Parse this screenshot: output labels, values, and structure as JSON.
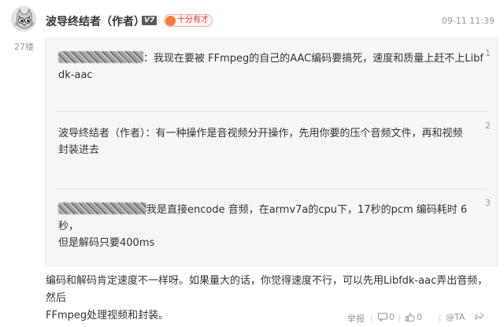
{
  "floor_label": "27楼",
  "author": {
    "name": "波导终结者（作者）",
    "level": "V7",
    "badge": "十分有才"
  },
  "timestamp": "09-11 11:39",
  "quotes": [
    {
      "number": "1",
      "speaker_hidden": true,
      "line1": "：我现在要被 FFmpeg的自己的AAC编码要搞死，速度和质量上赶不上Libf",
      "line2": "dk-aac"
    },
    {
      "number": "2",
      "speaker": "波导终结者（作者）",
      "line1": "：有一种操作是音视频分开操作，先用你要的压个音频文件，再和视频",
      "line2": "封装进去"
    },
    {
      "number": "3",
      "speaker_hidden": true,
      "line1": "我是直接encode 音频，在armv7a的cpu下，17秒的pcm 编码耗时 6秒，",
      "line2": "但是解码只要400ms"
    }
  ],
  "reply": {
    "line1": "编码和解码肯定速度不一样呀。如果量大的话，你觉得速度不行，可以先用Libfdk-aac弄出音频，然后",
    "line2": "FFmpeg处理视频和封装。"
  },
  "actions": {
    "report": "举报",
    "reply_count": "0",
    "like_count": "0",
    "tag": "@TA"
  }
}
